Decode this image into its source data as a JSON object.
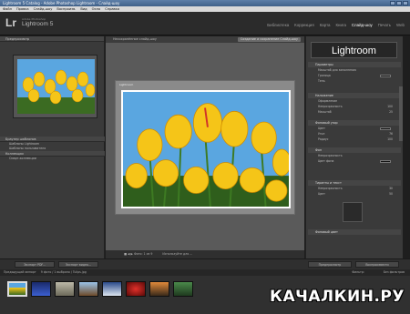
{
  "window": {
    "title": "Lightroom 5 Catalog - Adobe Photoshop Lightroom - Слайд-шоу"
  },
  "menu": [
    "Файл",
    "Правка",
    "Слайд-шоу",
    "Воспроизв.",
    "Вид",
    "Окно",
    "Справка"
  ],
  "logo": {
    "mark": "Lr",
    "subtitle": "Adobe Photoshop",
    "name": "Lightroom 5"
  },
  "modules": [
    {
      "label": "Библиотека",
      "active": false
    },
    {
      "label": "Коррекция",
      "active": false
    },
    {
      "label": "Карта",
      "active": false
    },
    {
      "label": "Книга",
      "active": false
    },
    {
      "label": "Слайд-шоу",
      "active": true
    },
    {
      "label": "Печать",
      "active": false
    },
    {
      "label": "Web",
      "active": false
    }
  ],
  "left_panel": {
    "preview_header": "Предпросмотр",
    "templates_header": "Браузер шаблонов",
    "templates": [
      "Шаблоны Lightroom",
      "Шаблоны пользователя"
    ],
    "collections_header": "Коллекции",
    "collections": [
      "Смарт-коллекции"
    ]
  },
  "center": {
    "top_label": "Несохранённое слайд-шоу",
    "create_button": "Создание и сохранение Слайд-шоу",
    "slide_label": "Lightroom",
    "bottom_label": "Фото: 1 из 9",
    "bottom_hint": "Используйте для ..."
  },
  "right_panel": {
    "brand": "Lightroom",
    "sections": [
      {
        "title": "Параметры",
        "rows": [
          "Масштаб для заполнения",
          "Граница",
          "Тень"
        ]
      },
      {
        "title": "Наложение",
        "rows": [
          "Оформление",
          "Непрозрачность",
          "Масштаб"
        ]
      },
      {
        "title": "Фоновый узор",
        "rows": [
          "Цвет",
          "Угол",
          "Радиус"
        ]
      },
      {
        "title": "Фон",
        "rows": [
          "Непрозрачность",
          "Цвет фона"
        ]
      },
      {
        "title": "Тиранты и текст",
        "rows": [
          "Непрозрачность",
          "Цвет"
        ]
      },
      {
        "title": "Фоновый цвет",
        "rows": []
      }
    ],
    "values": [
      "100",
      "25",
      "76",
      "100",
      "30",
      "50"
    ]
  },
  "bottom": {
    "export_pdf": "Экспорт PDF...",
    "export_video": "Экспорт видео...",
    "preview": "Предпросмотр",
    "play": "Воспроизвести"
  },
  "filmstrip": {
    "label": "Предыдущий импорт",
    "count": "9 фото / 1 выбрано / Tulips.jpg",
    "filter": "Фильтр:",
    "filter_value": "Без фильтров"
  },
  "watermark": "КАЧАЛКИН.РУ",
  "colors": {
    "panel": "#3a3a3a",
    "header": "#2b2b2b",
    "accent_active": "#ffffff",
    "tulip_yellow": "#f5c518",
    "sky_blue": "#5aa6e0"
  }
}
